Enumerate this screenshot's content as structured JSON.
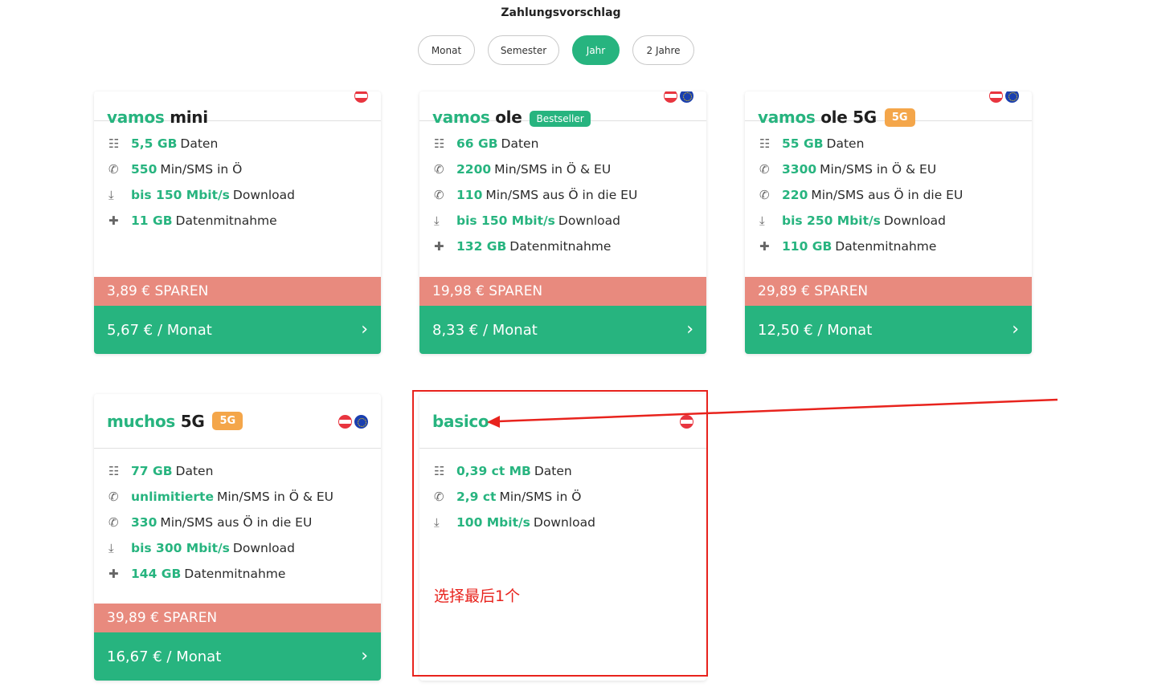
{
  "payment": {
    "title": "Zahlungsvorschlag",
    "tabs": [
      {
        "label": "Monat",
        "active": false
      },
      {
        "label": "Semester",
        "active": false
      },
      {
        "label": "Jahr",
        "active": true
      },
      {
        "label": "2 Jahre",
        "active": false
      }
    ]
  },
  "colors": {
    "accent": "#27b47f",
    "save": "#e88a7e",
    "badge_5g": "#f4a64a",
    "annotation": "#e8231d"
  },
  "plans": [
    {
      "name_main": "vamos",
      "name_extra": "mini",
      "badge": "",
      "flags": [
        "at"
      ],
      "features": [
        {
          "icon": "database-icon",
          "hl": "5,5 GB",
          "text": "Daten"
        },
        {
          "icon": "phone-icon",
          "hl": "550",
          "text": "Min/SMS in Ö"
        },
        {
          "icon": "download-icon",
          "hl": "bis 150 Mbit/s",
          "text": "Download"
        },
        {
          "icon": "plus-icon",
          "hl": "11 GB",
          "text": "Datenmitnahme"
        }
      ],
      "save": "3,89 € SPAREN",
      "price": "5,67 € / Monat"
    },
    {
      "name_main": "vamos",
      "name_extra": "ole",
      "badge": "Bestseller",
      "flags": [
        "at",
        "eu"
      ],
      "features": [
        {
          "icon": "database-icon",
          "hl": "66 GB",
          "text": "Daten"
        },
        {
          "icon": "phone-icon",
          "hl": "2200",
          "text": "Min/SMS in Ö & EU"
        },
        {
          "icon": "phone-icon",
          "hl": "110",
          "text": "Min/SMS aus Ö in die EU"
        },
        {
          "icon": "download-icon",
          "hl": "bis 150 Mbit/s",
          "text": "Download"
        },
        {
          "icon": "plus-icon",
          "hl": "132 GB",
          "text": "Datenmitnahme"
        }
      ],
      "save": "19,98 € SPAREN",
      "price": "8,33 € / Monat"
    },
    {
      "name_main": "vamos",
      "name_extra": "ole 5G",
      "badge": "5G",
      "flags": [
        "at",
        "eu"
      ],
      "features": [
        {
          "icon": "database-icon",
          "hl": "55 GB",
          "text": "Daten"
        },
        {
          "icon": "phone-icon",
          "hl": "3300",
          "text": "Min/SMS in Ö & EU"
        },
        {
          "icon": "phone-icon",
          "hl": "220",
          "text": "Min/SMS aus Ö in die EU"
        },
        {
          "icon": "download-icon",
          "hl": "bis 250 Mbit/s",
          "text": "Download"
        },
        {
          "icon": "plus-icon",
          "hl": "110 GB",
          "text": "Datenmitnahme"
        }
      ],
      "save": "29,89 € SPAREN",
      "price": "12,50 € / Monat"
    },
    {
      "name_main": "muchos",
      "name_extra": "5G",
      "badge": "5G",
      "flags": [
        "at",
        "eu"
      ],
      "features": [
        {
          "icon": "database-icon",
          "hl": "77 GB",
          "text": "Daten"
        },
        {
          "icon": "phone-icon",
          "hl": "unlimitierte",
          "text": "Min/SMS in Ö & EU"
        },
        {
          "icon": "phone-icon",
          "hl": "330",
          "text": "Min/SMS aus Ö in die EU"
        },
        {
          "icon": "download-icon",
          "hl": "bis 300 Mbit/s",
          "text": "Download"
        },
        {
          "icon": "plus-icon",
          "hl": "144 GB",
          "text": "Datenmitnahme"
        }
      ],
      "save": "39,89 € SPAREN",
      "price": "16,67 € / Monat"
    },
    {
      "name_main": "basico",
      "name_extra": "",
      "badge": "",
      "flags": [
        "at"
      ],
      "features": [
        {
          "icon": "database-icon",
          "hl": "0,39 ct MB",
          "text": "Daten"
        },
        {
          "icon": "phone-icon",
          "hl": "2,9 ct",
          "text": "Min/SMS in Ö"
        },
        {
          "icon": "download-icon",
          "hl": "100 Mbit/s",
          "text": "Download"
        }
      ],
      "save": "",
      "price": ""
    }
  ],
  "annotation": {
    "note": "选择最后1个"
  }
}
